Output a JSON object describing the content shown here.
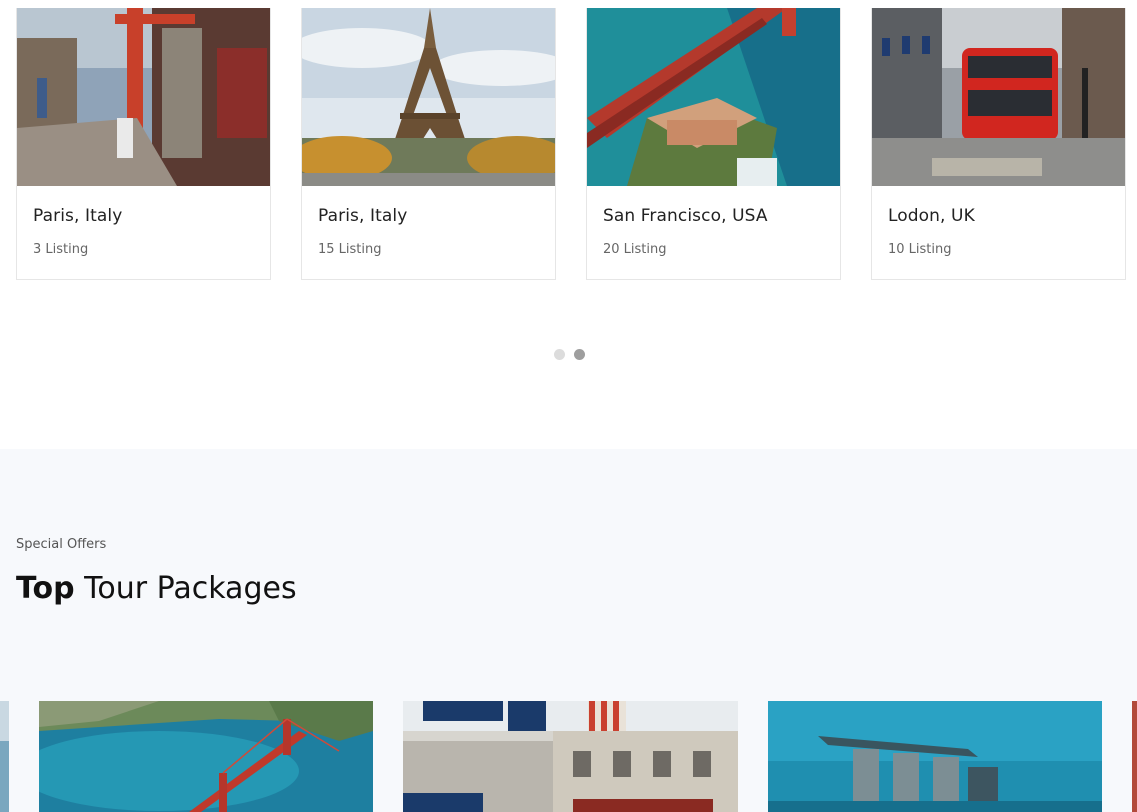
{
  "destinations": [
    {
      "name": "Paris, Italy",
      "count": "3 Listing",
      "image": "kyoto-street-photo"
    },
    {
      "name": "Paris, Italy",
      "count": "15 Listing",
      "image": "eiffel-tower-photo"
    },
    {
      "name": "San Francisco, USA",
      "count": "20 Listing",
      "image": "golden-gate-photo"
    },
    {
      "name": "Lodon, UK",
      "count": "10 Listing",
      "image": "london-bus-photo"
    }
  ],
  "carousel": {
    "dots": 2,
    "active_index": 1
  },
  "packages": {
    "eyebrow": "Special Offers",
    "title_bold": "Top",
    "title_rest": "Tour Packages",
    "cards": [
      {
        "image": "golden-gate-aerial-photo"
      },
      {
        "image": "london-street-photo"
      },
      {
        "image": "marina-bay-sands-photo"
      }
    ]
  },
  "colors": {
    "section_background": "#f7f9fc",
    "card_border": "#e6e6e6",
    "dot_active": "#9e9e9e",
    "dot_inactive": "#dcdcdc"
  }
}
